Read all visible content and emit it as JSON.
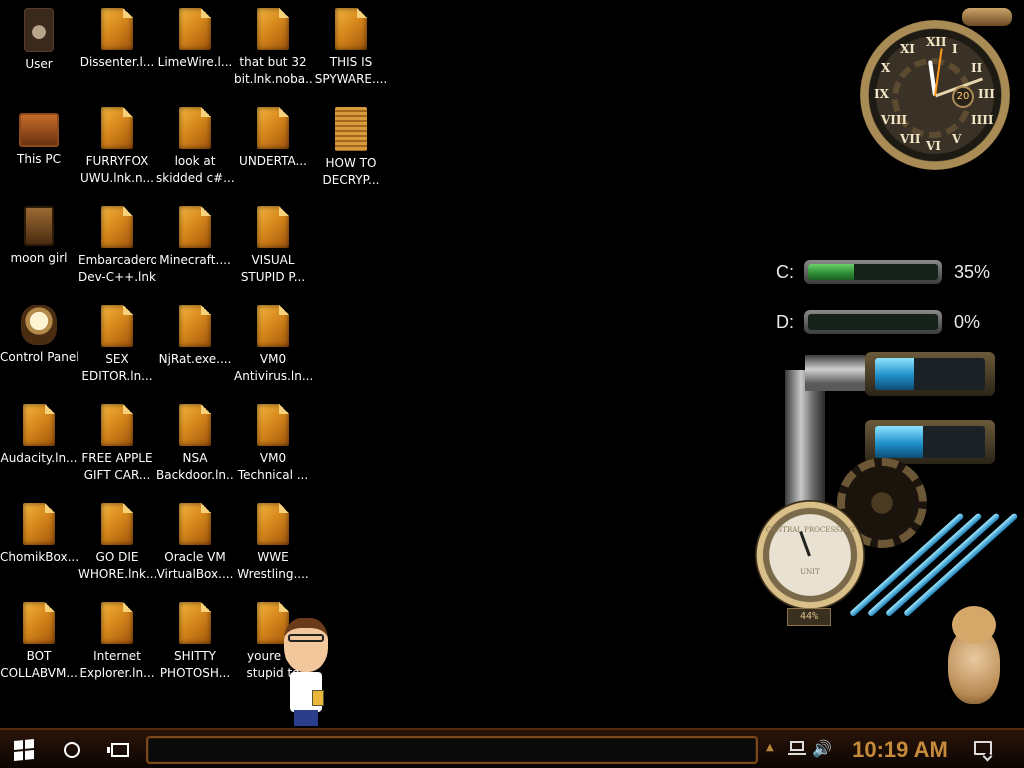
{
  "desktop": {
    "icons": [
      {
        "label": "User",
        "kind": "user"
      },
      {
        "label": "Dissenter.l...",
        "kind": "file"
      },
      {
        "label": "LimeWire.l...",
        "kind": "file"
      },
      {
        "label": "that but 32\nbit.lnk.noba...",
        "kind": "file"
      },
      {
        "label": "THIS IS\nSPYWARE....",
        "kind": "file"
      },
      {
        "label": "This PC",
        "kind": "pc"
      },
      {
        "label": "FURRYFOX\nUWU.lnk.n...",
        "kind": "file"
      },
      {
        "label": "look at\nskidded c#...",
        "kind": "file"
      },
      {
        "label": "UNDERTA...",
        "kind": "file"
      },
      {
        "label": "HOW TO\nDECRYP...",
        "kind": "doc"
      },
      {
        "label": "moon girl",
        "kind": "moon"
      },
      {
        "label": "Embarcadero\nDev-C++.lnk...",
        "kind": "file"
      },
      {
        "label": "Minecraft....",
        "kind": "file"
      },
      {
        "label": "VISUAL\nSTUPID P...",
        "kind": "file"
      },
      {
        "label": "Control Panel",
        "kind": "cp"
      },
      {
        "label": "SEX\nEDITOR.ln...",
        "kind": "file"
      },
      {
        "label": "NjRat.exe....",
        "kind": "file"
      },
      {
        "label": "VM0\nAntivirus.ln...",
        "kind": "file"
      },
      {
        "label": "Audacity.ln...",
        "kind": "file"
      },
      {
        "label": "FREE APPLE\nGIFT CAR...",
        "kind": "file"
      },
      {
        "label": "NSA\nBackdoor.ln...",
        "kind": "file"
      },
      {
        "label": "VM0\nTechnical ...",
        "kind": "file"
      },
      {
        "label": "ChomikBox....",
        "kind": "file"
      },
      {
        "label": "GO DIE\nWHORE.lnk...",
        "kind": "file"
      },
      {
        "label": "Oracle VM\nVirtualBox....",
        "kind": "file"
      },
      {
        "label": "WWE\nWrestling....",
        "kind": "file"
      },
      {
        "label": "BOT\nCOLLABVM...",
        "kind": "file"
      },
      {
        "label": "Internet\nExplorer.ln...",
        "kind": "file"
      },
      {
        "label": "SHITTY\nPHOTOSH...",
        "kind": "file"
      },
      {
        "label": "youre all\nstupid to",
        "kind": "file"
      }
    ]
  },
  "clock_gadget": {
    "date": "20",
    "numerals": [
      "XII",
      "I",
      "II",
      "III",
      "IIII",
      "V",
      "VI",
      "VII",
      "VIII",
      "IX",
      "X",
      "XI"
    ]
  },
  "drives": [
    {
      "letter": "C:",
      "percent_text": "35%",
      "fill": 0.35
    },
    {
      "letter": "D:",
      "percent_text": "0%",
      "fill": 0.0
    }
  ],
  "pipe_gadget": {
    "tank1_fill": 0.35,
    "tank2_fill": 0.44,
    "gauge_label_top": "CENTRAL PROCESSING",
    "gauge_label_bottom": "UNIT",
    "gauge_percent": "44%"
  },
  "taskbar": {
    "time": "10:19 AM",
    "volume_glyph": "🔊",
    "chevron_glyph": "▲"
  },
  "colors": {
    "taskbar_bg": "#1a0b04",
    "accent_copper": "#c58a3a"
  }
}
